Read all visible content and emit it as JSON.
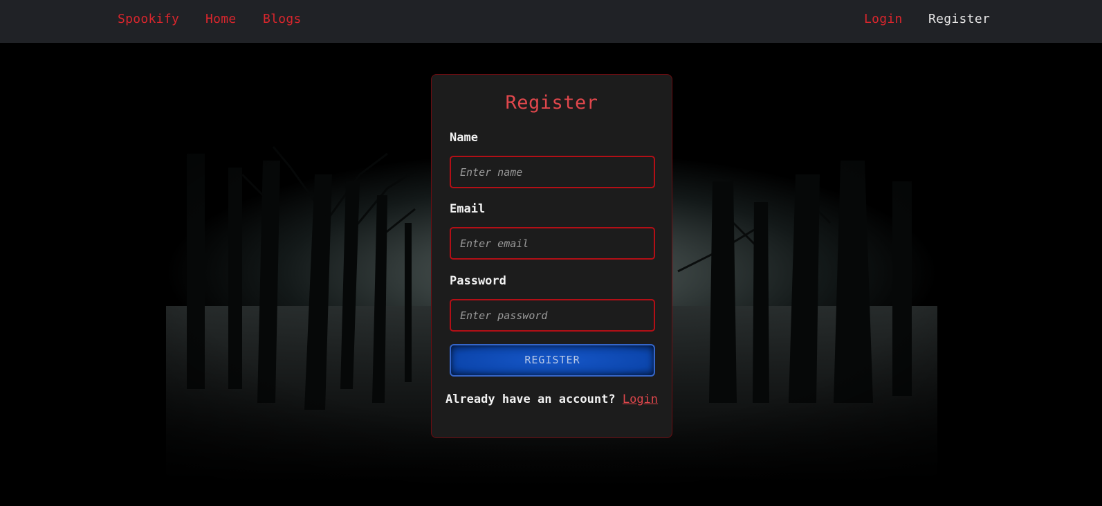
{
  "navbar": {
    "brand": "Spookify",
    "home": "Home",
    "blogs": "Blogs",
    "login": "Login",
    "register": "Register"
  },
  "form": {
    "title": "Register",
    "name_label": "Name",
    "name_placeholder": "Enter name",
    "email_label": "Email",
    "email_placeholder": "Enter email",
    "password_label": "Password",
    "password_placeholder": "Enter password",
    "submit_label": "REGISTER",
    "footer_text": "Already have an account?",
    "footer_link": "Login"
  },
  "colors": {
    "accent_red": "#d9262d",
    "button_blue": "#0c46ad",
    "card_bg": "#1c1c1c",
    "navbar_bg": "#202226"
  }
}
